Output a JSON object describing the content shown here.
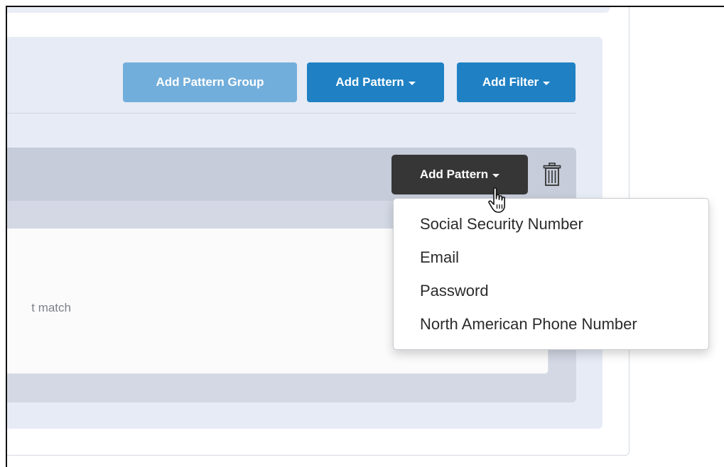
{
  "toolbar": {
    "add_pattern_group_label": "Add Pattern Group",
    "add_pattern_label": "Add Pattern",
    "add_filter_label": "Add Filter"
  },
  "pattern_group": {
    "add_pattern_label": "Add Pattern",
    "match_text": "t match"
  },
  "dropdown": {
    "items": [
      "Social Security Number",
      "Email",
      "Password",
      "North American Phone Number"
    ]
  },
  "icons": {
    "trash": "trash-icon",
    "caret": "caret-down-icon",
    "cursor": "hand-pointer-icon"
  },
  "colors": {
    "primary_button": "#1f81c4",
    "primary_button_light": "#72aedb",
    "dark_button": "#363636",
    "panel_bg": "#e6ebf5",
    "group_bg": "#d3d8e4"
  }
}
